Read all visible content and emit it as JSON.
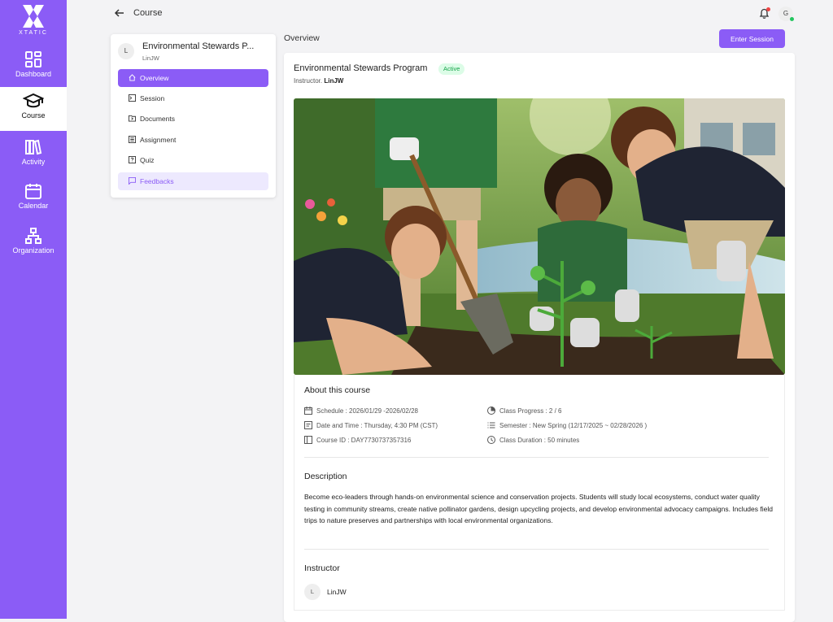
{
  "app": {
    "logo_text": "XTATIC"
  },
  "rail": {
    "items": [
      {
        "label": "Dashboard",
        "icon": "dashboard-icon"
      },
      {
        "label": "Course",
        "icon": "graduation-cap-icon"
      },
      {
        "label": "Activity",
        "icon": "books-icon"
      },
      {
        "label": "Calendar",
        "icon": "calendar-icon"
      },
      {
        "label": "Organization",
        "icon": "org-chart-icon"
      }
    ],
    "active": "Course"
  },
  "header": {
    "back_icon": "arrow-left-icon",
    "title": "Course",
    "avatar_initial": "G"
  },
  "course_nav": {
    "avatar_initial": "L",
    "title": "Environmental Stewards P...",
    "owner": "LinJW",
    "items": [
      {
        "label": "Overview",
        "icon": "home-icon"
      },
      {
        "label": "Session",
        "icon": "terminal-icon"
      },
      {
        "label": "Documents",
        "icon": "folder-icon"
      },
      {
        "label": "Assignment",
        "icon": "doc-list-icon"
      },
      {
        "label": "Quiz",
        "icon": "quiz-icon"
      },
      {
        "label": "Feedbacks",
        "icon": "chat-icon"
      }
    ],
    "selected": "Overview",
    "hovered": "Feedbacks"
  },
  "main": {
    "section_label": "Overview",
    "enter_button": "Enter Session",
    "course_title": "Environmental Stewards Program",
    "status": "Active",
    "instructor_prefix": "Instructor.",
    "instructor_name": "LinJW",
    "hero_image": "Students planting seedlings in a garden by a stream",
    "about_heading": "About this course",
    "schedule": "Schedule : 2026/01/29 -2026/02/28",
    "date_time": "Date and Time : Thursday, 4:30 PM (CST)",
    "course_id": "Course ID : DAY7730737357316",
    "class_progress": "Class Progress : 2 / 6",
    "semester": "Semester : New Spring (12/17/2025 ~ 02/28/2026 )",
    "class_duration": "Class Duration : 50 minutes",
    "description_heading": "Description",
    "description": "Become eco-leaders through hands-on environmental science and conservation projects. Students will study local ecosystems, conduct water quality testing in community streams, create native pollinator gardens, design upcycling projects, and develop environmental advocacy campaigns. Includes field trips to nature preserves and partnerships with local environmental organizations.",
    "instructor_heading": "Instructor",
    "instructor_avatar": "L",
    "instructor": "LinJW"
  },
  "colors": {
    "accent": "#8b5cf6",
    "active_green": "#16a34a",
    "bell_dot": "#ef4444",
    "online": "#22c55e"
  }
}
